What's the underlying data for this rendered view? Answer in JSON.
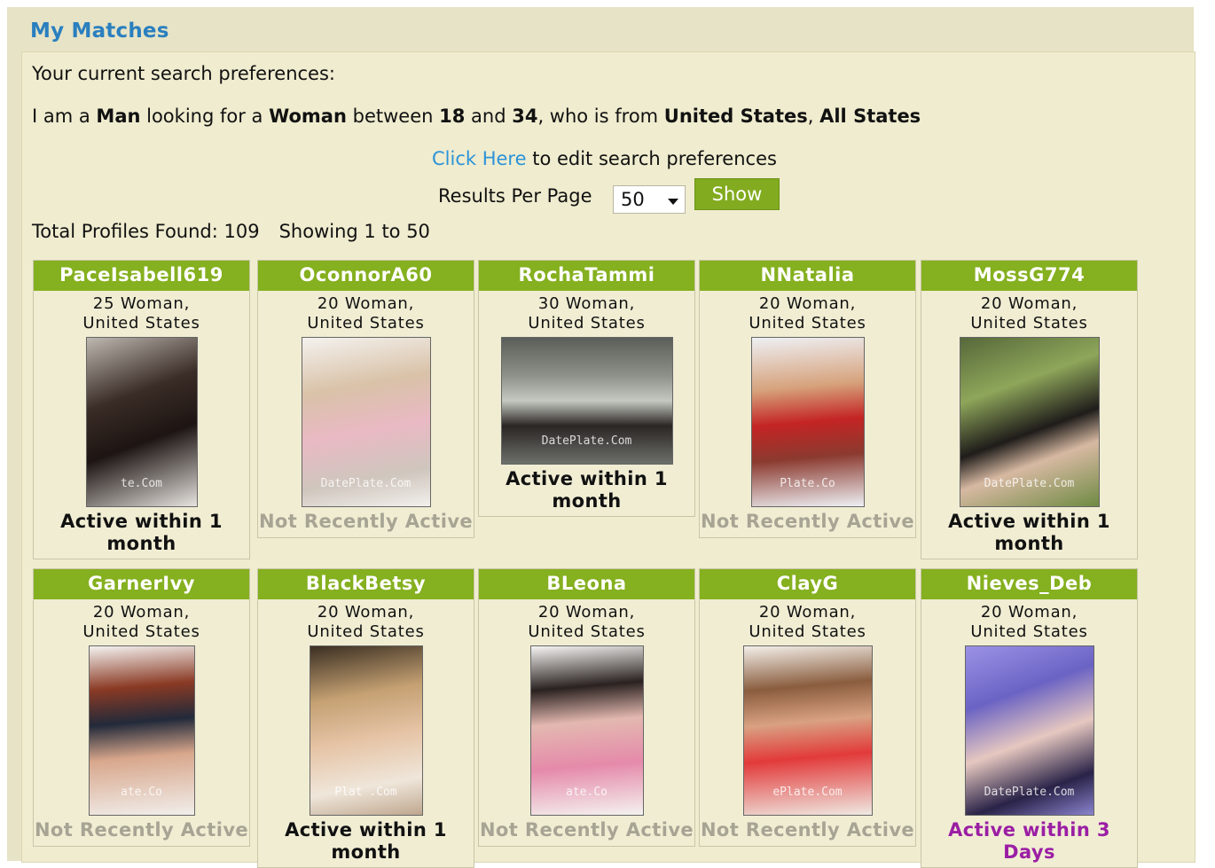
{
  "page": {
    "title": "My Matches"
  },
  "preferences": {
    "heading": "Your current search preferences:",
    "s1": "I am a ",
    "gender": "Man",
    "s2": " looking for a ",
    "seeking": "Woman",
    "s3": " between ",
    "age_min": "18",
    "s4": " and ",
    "age_max": "34",
    "s5": ", who is from ",
    "country": "United States",
    "s6": ", ",
    "region": "All States"
  },
  "edit": {
    "link": "Click Here",
    "text": " to edit search preferences"
  },
  "results": {
    "per_page_label": "Results Per Page",
    "per_page_value": "50",
    "show_button": "Show",
    "total_label": "Total Profiles Found: 109",
    "showing_label": "Showing 1 to 50"
  },
  "profiles": [
    {
      "name": "PaceIsabell619",
      "info1": "25 Woman,",
      "info2": "United States",
      "status_line1": "Active within 1",
      "status_line2": "month",
      "watermark": "te.Com"
    },
    {
      "name": "OconnorA60",
      "info1": "20 Woman,",
      "info2": "United States",
      "status_line1": "Not Recently Active",
      "status_line2": "",
      "watermark": "DatePlate.Com"
    },
    {
      "name": "RochaTammi",
      "info1": "30 Woman,",
      "info2": "United States",
      "status_line1": "Active within 1",
      "status_line2": "month",
      "watermark": "DatePlate.Com"
    },
    {
      "name": "NNatalia",
      "info1": "20 Woman,",
      "info2": "United States",
      "status_line1": "Not Recently Active",
      "status_line2": "",
      "watermark": "Plate.Co"
    },
    {
      "name": "MossG774",
      "info1": "20 Woman,",
      "info2": "United States",
      "status_line1": "Active within 1",
      "status_line2": "month",
      "watermark": "DatePlate.Com"
    },
    {
      "name": "GarnerIvy",
      "info1": "20 Woman,",
      "info2": "United States",
      "status_line1": "Not Recently Active",
      "status_line2": "",
      "watermark": "ate.Co"
    },
    {
      "name": "BlackBetsy",
      "info1": "20 Woman,",
      "info2": "United States",
      "status_line1": "Active within 1",
      "status_line2": "month",
      "watermark": "Plat .Com"
    },
    {
      "name": "BLeona",
      "info1": "20 Woman,",
      "info2": "United States",
      "status_line1": "Not Recently Active",
      "status_line2": "",
      "watermark": "ate.Co"
    },
    {
      "name": "ClayG",
      "info1": "20 Woman,",
      "info2": "United States",
      "status_line1": "Not Recently Active",
      "status_line2": "",
      "watermark": "ePlate.Com"
    },
    {
      "name": "Nieves_Deb",
      "info1": "20 Woman,",
      "info2": "United States",
      "status_line1": "Active within 3",
      "status_line2": "Days",
      "watermark": "DatePlate.Com"
    }
  ],
  "colors": {
    "background": "#e6e3c6",
    "panel": "#efeccf",
    "accent_green": "#85b01f",
    "link_blue": "#2c93d8",
    "title_blue": "#2a7fbf",
    "inactive_gray": "#a7a494",
    "recent_purple": "#9b1ea4"
  }
}
